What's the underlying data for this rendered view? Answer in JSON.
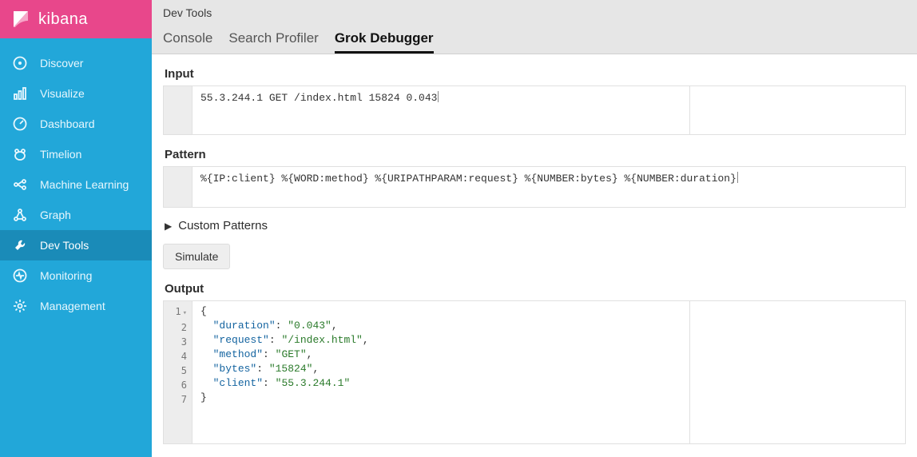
{
  "brand": "kibana",
  "sidebar": {
    "items": [
      {
        "label": "Discover",
        "name": "sidebar-item-discover",
        "icon": "compass-icon"
      },
      {
        "label": "Visualize",
        "name": "sidebar-item-visualize",
        "icon": "chart-icon"
      },
      {
        "label": "Dashboard",
        "name": "sidebar-item-dashboard",
        "icon": "gauge-icon"
      },
      {
        "label": "Timelion",
        "name": "sidebar-item-timelion",
        "icon": "bear-icon"
      },
      {
        "label": "Machine Learning",
        "name": "sidebar-item-ml",
        "icon": "ml-icon"
      },
      {
        "label": "Graph",
        "name": "sidebar-item-graph",
        "icon": "graph-icon"
      },
      {
        "label": "Dev Tools",
        "name": "sidebar-item-devtools",
        "icon": "wrench-icon",
        "active": true
      },
      {
        "label": "Monitoring",
        "name": "sidebar-item-monitoring",
        "icon": "heartbeat-icon"
      },
      {
        "label": "Management",
        "name": "sidebar-item-management",
        "icon": "gear-icon"
      }
    ]
  },
  "topbar": {
    "title": "Dev Tools"
  },
  "tabs": [
    {
      "label": "Console",
      "name": "tab-console"
    },
    {
      "label": "Search Profiler",
      "name": "tab-search-profiler"
    },
    {
      "label": "Grok Debugger",
      "name": "tab-grok-debugger",
      "active": true
    }
  ],
  "sections": {
    "input_label": "Input",
    "input_value": "55.3.244.1 GET /index.html 15824 0.043",
    "pattern_label": "Pattern",
    "pattern_value": "%{IP:client} %{WORD:method} %{URIPATHPARAM:request} %{NUMBER:bytes} %{NUMBER:duration}",
    "custom_label": "Custom Patterns",
    "simulate_label": "Simulate",
    "output_label": "Output"
  },
  "output": {
    "lines": [
      "1",
      "2",
      "3",
      "4",
      "5",
      "6",
      "7"
    ],
    "json": {
      "duration": "0.043",
      "request": "/index.html",
      "method": "GET",
      "bytes": "15824",
      "client": "55.3.244.1"
    }
  },
  "icons": {
    "compass-icon": "<circle cx='9' cy='9' r='7.5'/><circle cx='9' cy='9' r='2' fill='currentColor' stroke='none'/>",
    "chart-icon": "<rect x='2' y='10' width='3' height='6'/><rect x='7.5' y='6' width='3' height='10'/><rect x='13' y='2' width='3' height='14'/>",
    "gauge-icon": "<circle cx='9' cy='9' r='7.5'/><path d='M9 9 L13 5'/>",
    "bear-icon": "<circle cx='5' cy='5' r='2'/><circle cx='13' cy='5' r='2'/><ellipse cx='9' cy='11' rx='6' ry='5'/>",
    "ml-icon": "<circle cx='4' cy='9' r='2'/><circle cx='14' cy='5' r='2'/><circle cx='14' cy='13' r='2'/><path d='M6 9 L12 5 M6 9 L12 13'/>",
    "graph-icon": "<circle cx='4' cy='14' r='2'/><circle cx='9' cy='4' r='2'/><circle cx='14' cy='14' r='2'/><path d='M5 12 L8 6 M10 6 L13 12 M6 14 L12 14'/>",
    "wrench-icon": "<path d='M12 3 a4 4 0 0 0-5 5 L3 12 l3 3 4-4 a4 4 0 0 0 5-5 l-3 3-2-2 z' fill='currentColor' stroke='none'/>",
    "heartbeat-icon": "<circle cx='9' cy='9' r='7.5'/><path d='M4 9 L7 9 L8 6 L10 12 L11 9 L14 9'/>",
    "gear-icon": "<circle cx='9' cy='9' r='2.5'/><path d='M9 1 v3 M9 14 v3 M1 9 h3 M14 9 h3 M3.5 3.5 l2 2 M12.5 12.5 l2 2 M14.5 3.5 l-2 2 M5.5 12.5 l-2 2'/>"
  }
}
